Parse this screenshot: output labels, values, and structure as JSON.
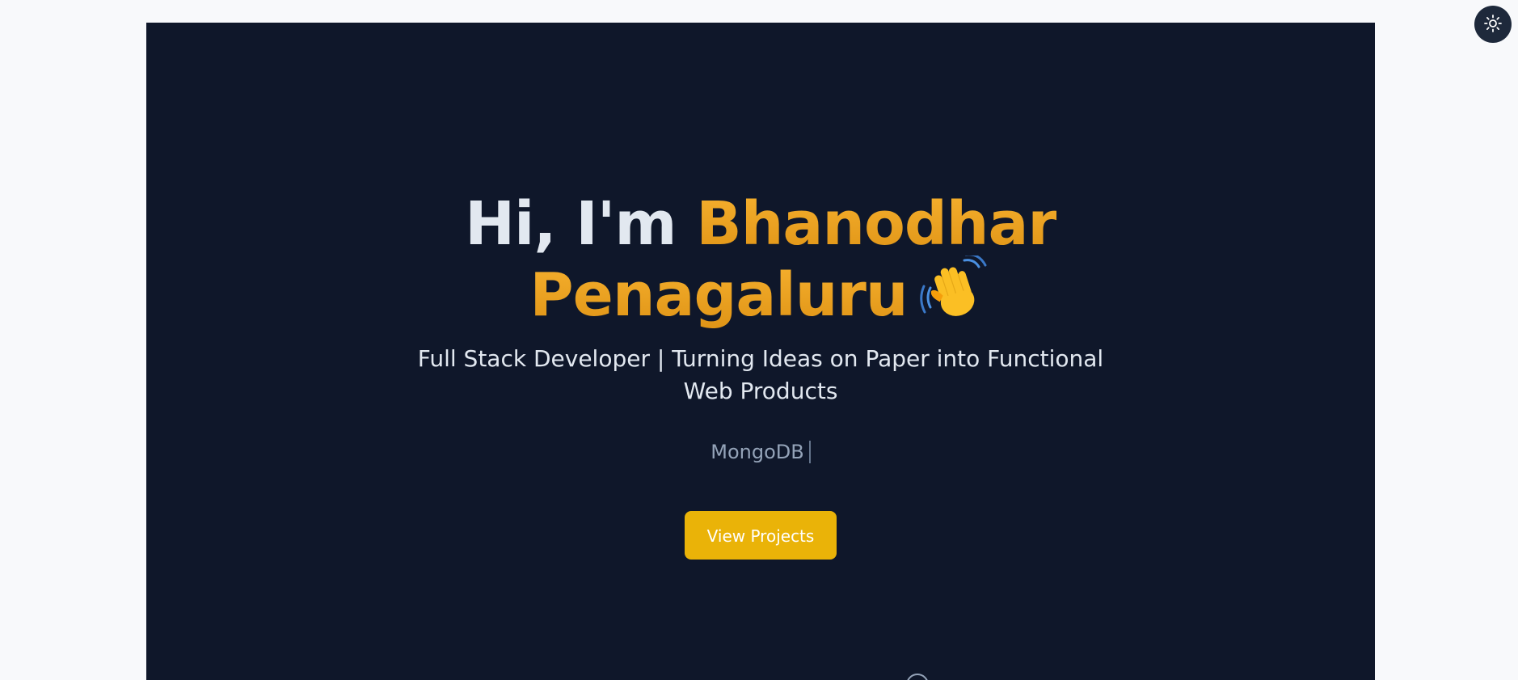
{
  "hero": {
    "greeting": "Hi, I'm ",
    "name_line1": "Bhanodhar",
    "name_line2": "Penagaluru",
    "subtitle": "Full Stack Developer | Turning Ideas on Paper into Functional Web Products",
    "typing_text": "MongoDB",
    "cta_label": "View Projects"
  },
  "icons": {
    "wave": "waving-hand-icon",
    "theme_toggle": "sun-icon",
    "scroll": "mouse-scroll-icon"
  },
  "colors": {
    "page_bg": "#f8f9fb",
    "hero_bg": "#0f172a",
    "accent": "#f2a52a",
    "cta_bg": "#eab308",
    "text_light": "#e2e8f0",
    "text_muted": "#94a3b8",
    "toggle_bg": "#1e293b"
  }
}
